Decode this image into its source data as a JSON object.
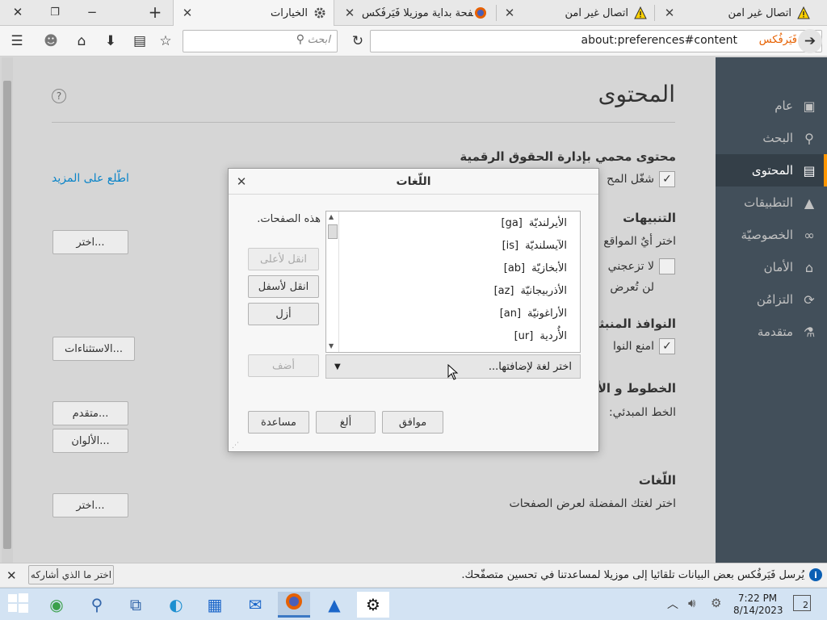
{
  "tabs": [
    {
      "label": "الخيارات",
      "icon": "gear-icon",
      "active": true
    },
    {
      "label": "صفحة بداية موزيلا فَيَرفُكس",
      "icon": "firefox-icon",
      "active": false
    },
    {
      "label": "اتصال غير آمن",
      "icon": "warning-icon",
      "active": false
    },
    {
      "label": "اتصال غير آمن",
      "icon": "warning-icon",
      "active": false
    }
  ],
  "navbar": {
    "url": "about:preferences#content",
    "identity_label": "فَيَرفُكس",
    "search_placeholder": "ابحث"
  },
  "sidebar": {
    "items": [
      {
        "label": "عام",
        "icon": "general-icon"
      },
      {
        "label": "البحث",
        "icon": "search-icon"
      },
      {
        "label": "المحتوى",
        "icon": "content-icon",
        "selected": true
      },
      {
        "label": "التطبيقات",
        "icon": "applications-icon"
      },
      {
        "label": "الخصوصيّة",
        "icon": "privacy-icon"
      },
      {
        "label": "الأمان",
        "icon": "security-icon"
      },
      {
        "label": "التزامُن",
        "icon": "sync-icon"
      },
      {
        "label": "متقدمة",
        "icon": "advanced-icon"
      }
    ]
  },
  "main": {
    "title": "المحتوى",
    "drm_heading": "محتوى محمي بإدارة الحقوق الرقمية",
    "drm_checkbox_label": "شغّل المح",
    "learn_more": "اطّلع على المزيد",
    "notifications_heading": "التنبيهات",
    "notifications_text": "اختر أيٌ المواقع",
    "choose_btn_1": "اختر...",
    "dnd_label": "لا تزعجني",
    "dnd_sub": "لن تُعرض",
    "popups_heading": "النوافذ المنبثقة",
    "popups_label": "امنع النوا",
    "exceptions_btn": "الاستثناءات...",
    "fonts_heading": "الخطوط و الألوا",
    "default_font_label": "الخط المبدئي:",
    "advanced_btn": "متقدم...",
    "colors_btn": "الألوان...",
    "languages_heading": "اللّغات",
    "languages_text": "اختر لغتك المفضلة لعرض الصفحات",
    "choose_btn_2": "اختر..."
  },
  "dialog": {
    "title": "اللّغات",
    "intro_text": "هذه الصفحات.",
    "languages": [
      {
        "name": "الأيرلنديّة",
        "code": "[ga]"
      },
      {
        "name": "الآيسلنديّة",
        "code": "[is]"
      },
      {
        "name": "الأبخازيّة",
        "code": "[ab]"
      },
      {
        "name": "الأذربيجانيّة",
        "code": "[az]"
      },
      {
        "name": "الأراغونيّة",
        "code": "[an]"
      },
      {
        "name": "الأُردية",
        "code": "[ur]"
      }
    ],
    "move_up": "انقل لأعلى",
    "move_down": "انقل لأسفل",
    "remove": "أزل",
    "add": "أضف",
    "add_select_placeholder": "اختر لغة لإضافتها...",
    "ok": "موافق",
    "cancel": "ألغ",
    "help": "مساعدة"
  },
  "notification": {
    "text": "يُرسل فَيَرفُكس بعض البيانات تلقائيا إلى موزيلا لمساعدتنا في تحسين متصفّحك.",
    "button": "اختر ما الذي أشاركه"
  },
  "taskbar": {
    "time": "7:22 PM",
    "date": "8/14/2023",
    "notification_count": "2"
  },
  "colors": {
    "sidebar_bg": "#424f5a",
    "accent": "#ff9500",
    "link": "#0a84c8"
  }
}
